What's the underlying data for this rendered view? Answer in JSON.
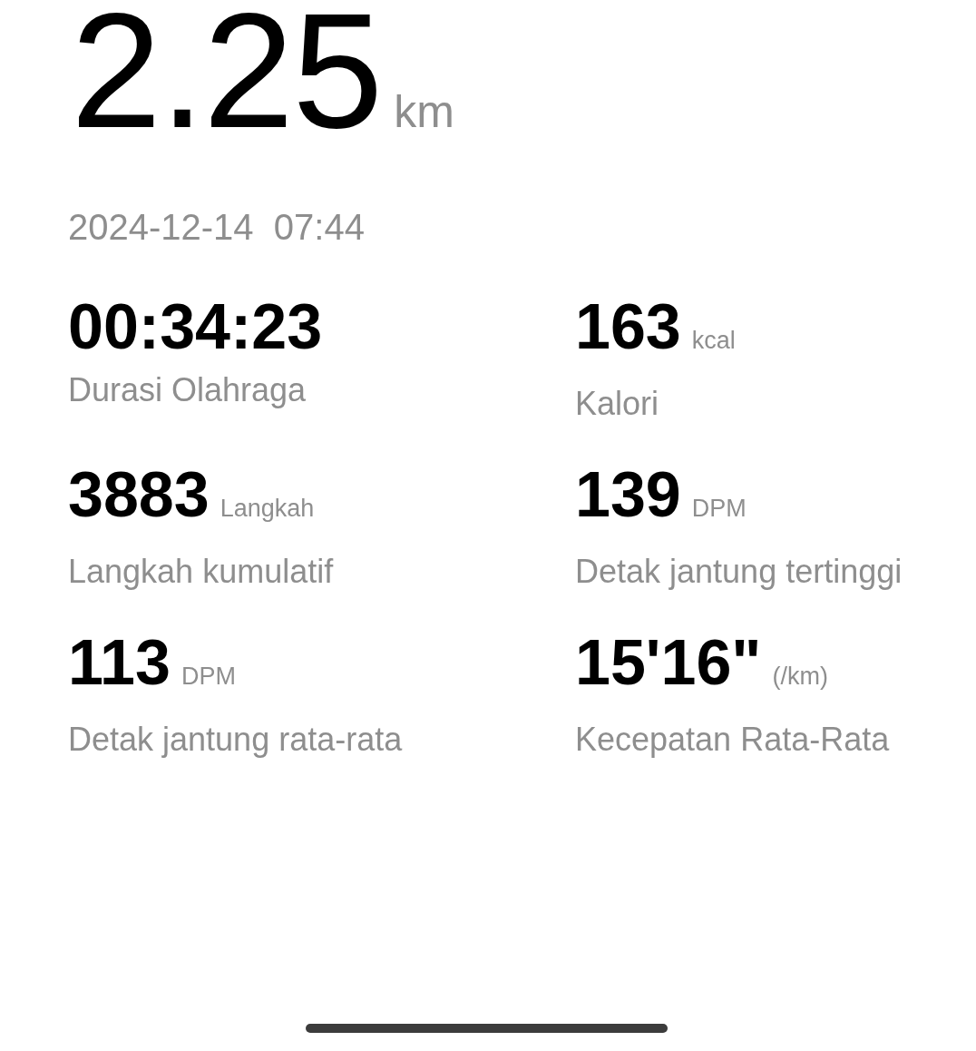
{
  "distance": {
    "value": "2.25",
    "unit": "km"
  },
  "datetime": "2024-12-14  07:44",
  "stats": [
    {
      "value": "00:34:23",
      "label": "Durasi Olahraga"
    },
    {
      "value": "163",
      "unit": "kcal",
      "label": "Kalori"
    },
    {
      "value": "3883",
      "unit": "Langkah",
      "label": "Langkah kumulatif"
    },
    {
      "value": "139",
      "unit": "DPM",
      "label": "Detak jantung tertinggi"
    },
    {
      "value": "113",
      "unit": "DPM",
      "label": "Detak jantung rata-rata"
    },
    {
      "value": "15'16\"",
      "unit": "(/km)",
      "label": "Kecepatan Rata-Rata"
    }
  ]
}
